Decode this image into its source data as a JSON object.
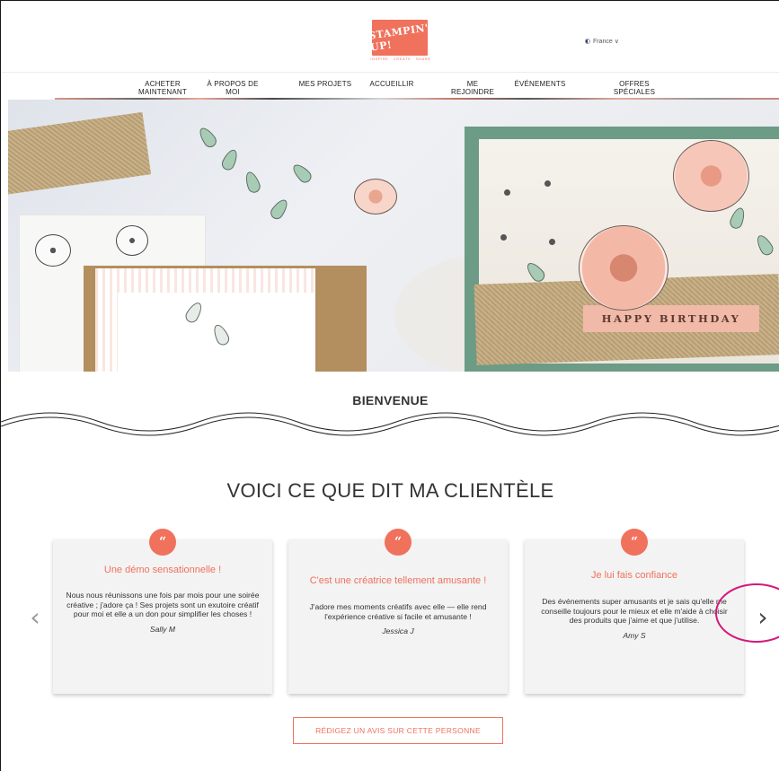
{
  "header": {
    "logo_text": "STAMPIN' UP!",
    "tagline": "INSPIRE · CREATE · SHARE",
    "language": "France ∨"
  },
  "nav": {
    "items": [
      {
        "label": "ACHETER\nMAINTENANT"
      },
      {
        "label": "À PROPOS DE\nMOI"
      },
      {
        "label": "MES PROJETS"
      },
      {
        "label": "ACCUEILLIR"
      },
      {
        "label": "ME\nREJOINDRE"
      },
      {
        "label": "ÉVÉNEMENTS"
      },
      {
        "label": "OFFRES\nSPÉCIALES"
      }
    ]
  },
  "hero": {
    "banner_text": "HAPPY BIRTHDAY"
  },
  "welcome": {
    "title": "BIENVENUE"
  },
  "testimonials": {
    "title": "VOICI CE QUE DIT MA CLIENTÈLE",
    "quote_mark": "“",
    "prev_arrow": "‹",
    "next_arrow": "›",
    "cards": [
      {
        "title": "Une démo sensationnelle !",
        "body": "Nous nous réunissons une fois par mois pour une soirée créative ; j'adore ça ! Ses projets sont un exutoire créatif pour moi et elle a un don pour simplifier les choses !",
        "author": "Sally M"
      },
      {
        "title": "C'est une créatrice tellement amusante !",
        "body": "J'adore mes moments créatifs avec elle — elle rend l'expérience créative si facile et amusante !",
        "author": "Jessica J"
      },
      {
        "title": "Je lui fais confiance",
        "body": "Des événements super amusants et je sais qu'elle me conseille toujours pour le mieux et elle m'aide à choisir des produits que j'aime et que j'utilise.",
        "author": "Amy S"
      }
    ]
  },
  "review_button": {
    "label": "RÉDIGEZ UN AVIS SUR CETTE PERSONNE"
  },
  "colors": {
    "brand": "#f0715c",
    "highlight": "#d4197b"
  }
}
